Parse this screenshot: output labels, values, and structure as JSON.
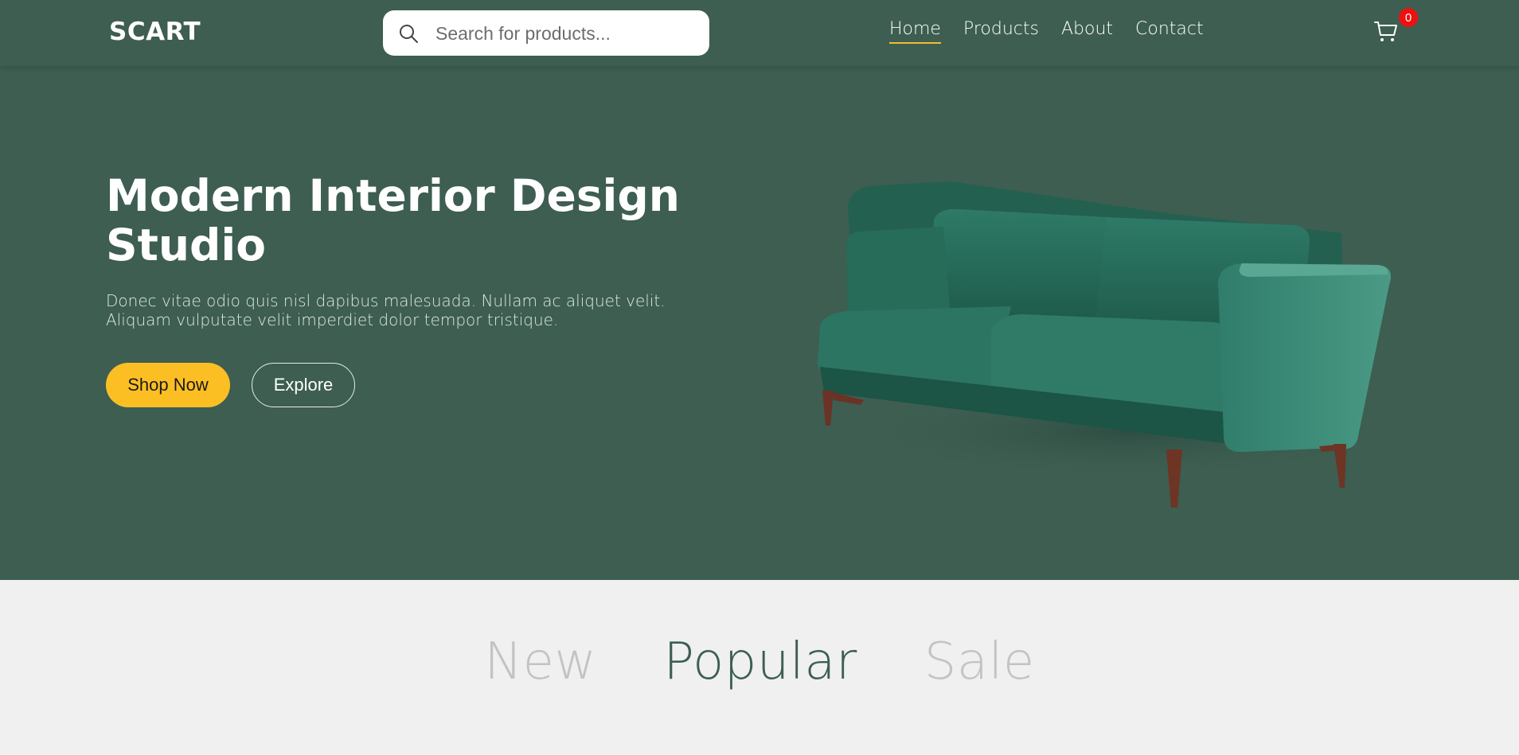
{
  "brand": {
    "logo": "SCART"
  },
  "search": {
    "placeholder": "Search for products..."
  },
  "nav": {
    "links": [
      {
        "label": "Home",
        "active": true
      },
      {
        "label": "Products",
        "active": false
      },
      {
        "label": "About",
        "active": false
      },
      {
        "label": "Contact",
        "active": false
      }
    ]
  },
  "cart": {
    "count": "0",
    "icon": "cart-icon"
  },
  "hero": {
    "title": "Modern Interior Design Studio",
    "description": "Donec vitae odio quis nisl dapibus malesuada. Nullam ac aliquet velit. Aliquam vulputate velit imperdiet dolor tempor tristique.",
    "primary_button": "Shop Now",
    "secondary_button": "Explore"
  },
  "tabs": [
    {
      "label": "New",
      "active": false
    },
    {
      "label": "Popular",
      "active": true
    },
    {
      "label": "Sale",
      "active": false
    }
  ],
  "colors": {
    "primary": "#3d5e51",
    "accent": "#fbbf24",
    "badge": "#ee1111",
    "background": "#eff0ef",
    "inactive_tab": "#c2c4c3"
  }
}
